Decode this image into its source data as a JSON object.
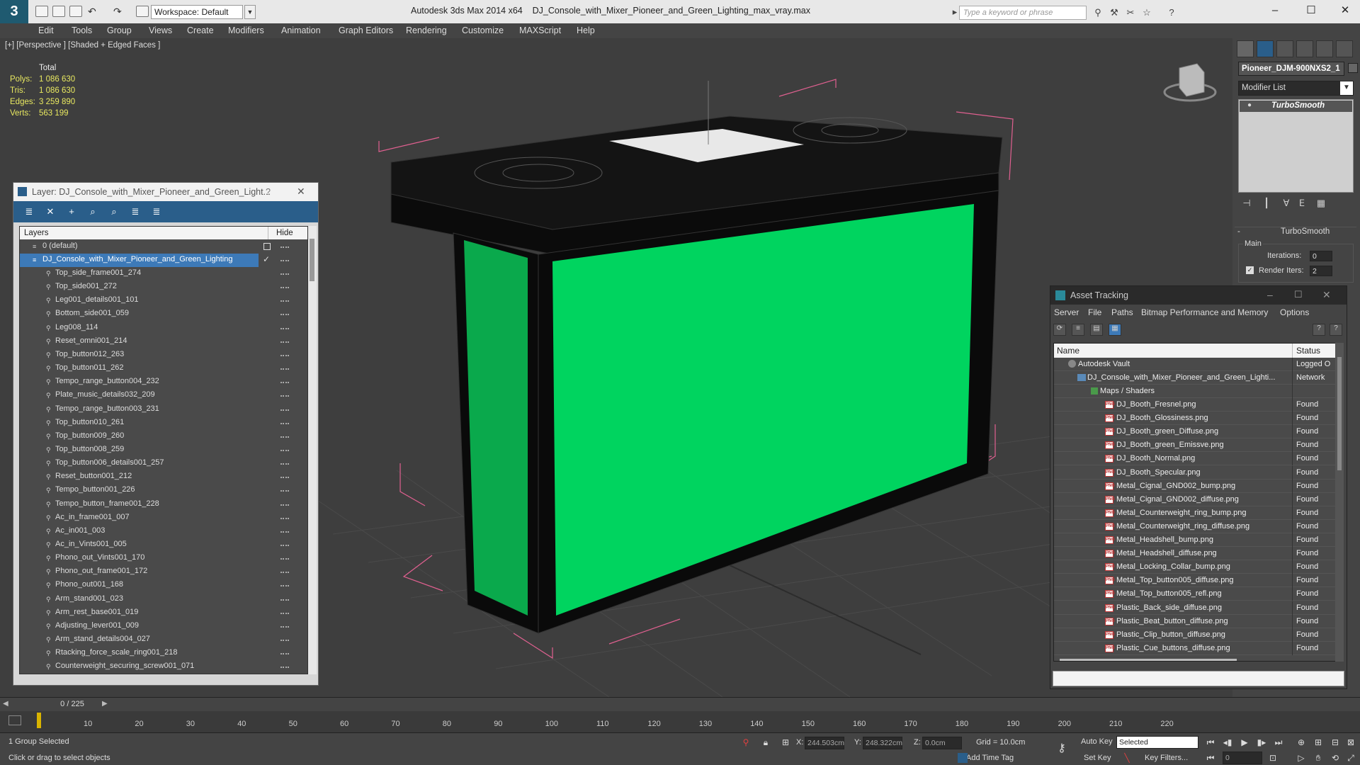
{
  "app": {
    "title": "Autodesk 3ds Max  2014 x64",
    "file": "DJ_Console_with_Mixer_Pioneer_and_Green_Lighting_max_vray.max",
    "workspace": "Workspace: Default",
    "search_placeholder": "Type a keyword or phrase"
  },
  "menu": [
    "Edit",
    "Tools",
    "Group",
    "Views",
    "Create",
    "Modifiers",
    "Animation",
    "Graph Editors",
    "Rendering",
    "Customize",
    "MAXScript",
    "Help"
  ],
  "viewport": {
    "label": "[+] [Perspective ] [Shaded + Edged Faces ]",
    "stats": {
      "header": "Total",
      "rows": [
        {
          "k": "Polys:",
          "v": "1 086 630"
        },
        {
          "k": "Tris:",
          "v": "1 086 630"
        },
        {
          "k": "Edges:",
          "v": "3 259 890"
        },
        {
          "k": "Verts:",
          "v": "563 199"
        }
      ]
    },
    "colors": {
      "green": "#00d45f",
      "dark_green": "#0aa94c",
      "background": "#3e3e3e",
      "bbox": "#e06090"
    }
  },
  "command_panel": {
    "object_name": "Pioneer_DJM-900NXS2_1",
    "modifier_list": "Modifier List",
    "stack_item": "TurboSmooth",
    "rollout": "TurboSmooth",
    "group": "Main",
    "iterations_label": "Iterations:",
    "iterations": "0",
    "render_iters_label": "Render Iters:",
    "render_iters": "2"
  },
  "layer_dialog": {
    "title": "Layer: DJ_Console_with_Mixer_Pioneer_and_Green_Light...",
    "help": "?",
    "col_layers": "Layers",
    "col_hide": "Hide",
    "default_layer": "0 (default)",
    "active_layer": "DJ_Console_with_Mixer_Pioneer_and_Green_Lighting",
    "objects": [
      "Top_side_frame001_274",
      "Top_side001_272",
      "Leg001_details001_101",
      "Bottom_side001_059",
      "Leg008_114",
      "Reset_omni001_214",
      "Top_button012_263",
      "Top_button011_262",
      "Tempo_range_button004_232",
      "Plate_music_details032_209",
      "Tempo_range_button003_231",
      "Top_button010_261",
      "Top_button009_260",
      "Top_button008_259",
      "Top_button006_details001_257",
      "Reset_button001_212",
      "Tempo_button001_226",
      "Tempo_button_frame001_228",
      "Ac_in_frame001_007",
      "Ac_in001_003",
      "Ac_in_Vints001_005",
      "Phono_out_Vints001_170",
      "Phono_out_frame001_172",
      "Phono_out001_168",
      "Arm_stand001_023",
      "Arm_rest_base001_019",
      "Adjusting_lever001_009",
      "Arm_stand_details004_027",
      "Rtacking_force_scale_ring001_218",
      "Counterweight_securing_screw001_071"
    ]
  },
  "asset_dialog": {
    "title": "Asset Tracking",
    "menu": [
      "Server",
      "File",
      "Paths",
      "Bitmap Performance and Memory",
      "Options"
    ],
    "col_name": "Name",
    "col_status": "Status",
    "vault": {
      "name": "Autodesk Vault",
      "status": "Logged O"
    },
    "maxfile": {
      "name": "DJ_Console_with_Mixer_Pioneer_and_Green_Lighti...",
      "status": "Network"
    },
    "maps_folder": "Maps / Shaders",
    "files": [
      {
        "name": "DJ_Booth_Fresnel.png",
        "status": "Found"
      },
      {
        "name": "DJ_Booth_Glossiness.png",
        "status": "Found"
      },
      {
        "name": "DJ_Booth_green_Diffuse.png",
        "status": "Found"
      },
      {
        "name": "DJ_Booth_green_Emissve.png",
        "status": "Found"
      },
      {
        "name": "DJ_Booth_Normal.png",
        "status": "Found"
      },
      {
        "name": "DJ_Booth_Specular.png",
        "status": "Found"
      },
      {
        "name": "Metal_Cignal_GND002_bump.png",
        "status": "Found"
      },
      {
        "name": "Metal_Cignal_GND002_diffuse.png",
        "status": "Found"
      },
      {
        "name": "Metal_Counterweight_ring_bump.png",
        "status": "Found"
      },
      {
        "name": "Metal_Counterweight_ring_diffuse.png",
        "status": "Found"
      },
      {
        "name": "Metal_Headshell_bump.png",
        "status": "Found"
      },
      {
        "name": "Metal_Headshell_diffuse.png",
        "status": "Found"
      },
      {
        "name": "Metal_Locking_Collar_bump.png",
        "status": "Found"
      },
      {
        "name": "Metal_Top_button005_diffuse.png",
        "status": "Found"
      },
      {
        "name": "Metal_Top_button005_refl.png",
        "status": "Found"
      },
      {
        "name": "Plastic_Back_side_diffuse.png",
        "status": "Found"
      },
      {
        "name": "Plastic_Beat_button_diffuse.png",
        "status": "Found"
      },
      {
        "name": "Plastic_Clip_button_diffuse.png",
        "status": "Found"
      },
      {
        "name": "Plastic_Cue_buttons_diffuse.png",
        "status": "Found"
      }
    ]
  },
  "timeline": {
    "frame": "0 / 225",
    "ticks": [
      "10",
      "20",
      "30",
      "40",
      "50",
      "60",
      "70",
      "80",
      "90",
      "100",
      "110",
      "120",
      "130",
      "140",
      "150",
      "160",
      "170",
      "180",
      "190",
      "200",
      "210",
      "220"
    ]
  },
  "status": {
    "selection": "1 Group Selected",
    "prompt": "Click or drag to select objects",
    "x_label": "X:",
    "x": "244.503cm",
    "y_label": "Y:",
    "y": "248.322cm",
    "z_label": "Z:",
    "z": "0.0cm",
    "grid": "Grid = 10.0cm",
    "auto_key": "Auto Key",
    "selected": "Selected",
    "set_key": "Set Key",
    "key_filters": "Key Filters...",
    "add_time_tag": "Add Time Tag",
    "frame_field": "0"
  }
}
